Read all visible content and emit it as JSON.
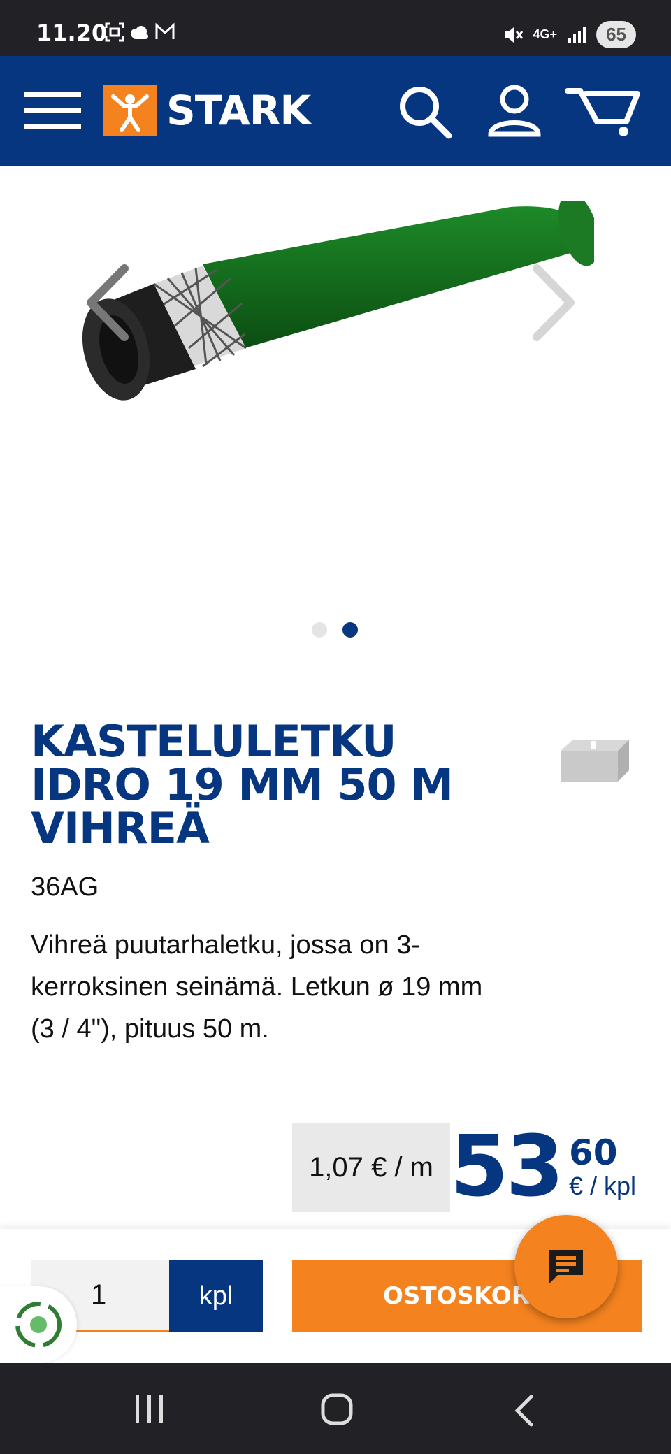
{
  "status_bar": {
    "time": "11.20",
    "network": "4G+",
    "battery": "65",
    "icons_left": [
      "screenshot-icon",
      "weather-icon",
      "gmail-icon"
    ],
    "icons_right": [
      "mute-icon",
      "network-icon",
      "signal-icon",
      "battery-icon"
    ]
  },
  "header": {
    "brand": "STARK",
    "colors": {
      "background": "#063680",
      "logo_box": "#f4821f"
    },
    "icons": [
      "menu-icon",
      "search-icon",
      "account-icon",
      "cart-icon"
    ]
  },
  "gallery": {
    "image": "green-garden-hose",
    "slide_count": 2,
    "active_slide": 2
  },
  "product": {
    "title": "KASTELULETKU IDRO 19 MM 50 M VIHREÄ",
    "sku": "36AG",
    "description": "Vihreä puutarhaletku, jossa on 3-kerroksinen seinämä. Letkun ø 19 mm (3 / 4\"), pituus 50 m.",
    "delivery_icon": "pallet-icon"
  },
  "price": {
    "unit_price": "1,07 € / m",
    "main_int": "53",
    "main_dec": "60",
    "unit": "€ / kpl"
  },
  "purchase": {
    "quantity": "1",
    "unit_label": "kpl",
    "add_to_cart": "OSTOSKORIIN",
    "colors": {
      "primary": "#063680",
      "accent": "#f4821f"
    }
  },
  "nav_bar": {
    "icons": [
      "recent-apps-icon",
      "home-icon",
      "back-icon"
    ]
  }
}
